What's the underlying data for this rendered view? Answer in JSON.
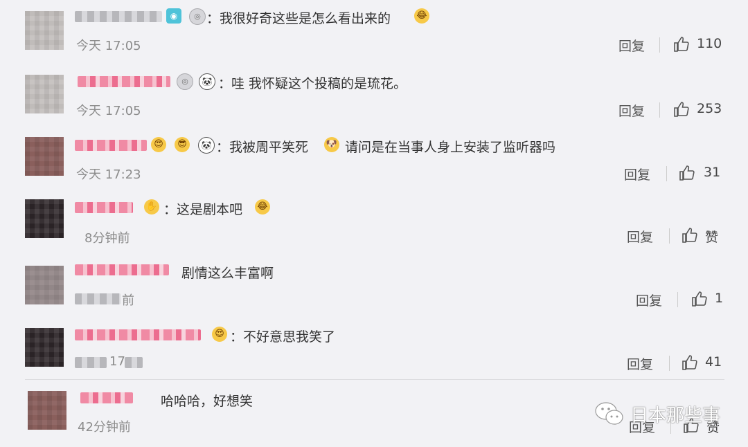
{
  "comments": [
    {
      "text": "：我很好奇这些是怎么看出来的",
      "time": "今天 17:05",
      "reply": "回复",
      "likes": "110"
    },
    {
      "text": "：哇 我怀疑这个投稿的是琉花。",
      "time": "今天 17:05",
      "reply": "回复",
      "likes": "253"
    },
    {
      "text_a": "：我被周平笑死",
      "text_b": "请问是在当事人身上安装了监听器吗",
      "time": "今天 17:23",
      "reply": "回复",
      "likes": "31"
    },
    {
      "text": "：这是剧本吧",
      "time": "8分钟前",
      "reply": "回复",
      "likes": "赞"
    },
    {
      "text": "剧情这么丰富啊",
      "time": "前",
      "reply": "回复",
      "likes": "1"
    },
    {
      "text": "：不好意思我笑了",
      "time": "17",
      "reply": "回复",
      "likes": "41"
    },
    {
      "text": "哈哈哈，好想笑",
      "time": "42分钟前",
      "reply": "回复",
      "likes": "赞"
    }
  ],
  "icons": {
    "like": "thumbs-up-icon",
    "medal": "medal-icon",
    "panda": "panda-emoji",
    "laugh": "laugh-emoji",
    "camera": "camera-icon"
  },
  "watermark": {
    "text": "日本那些事",
    "icon": "wechat-icon"
  },
  "colors": {
    "background": "#f2f2f5",
    "text": "#333333",
    "meta": "#8c8c8c",
    "name_pink": "#f08aa4"
  }
}
